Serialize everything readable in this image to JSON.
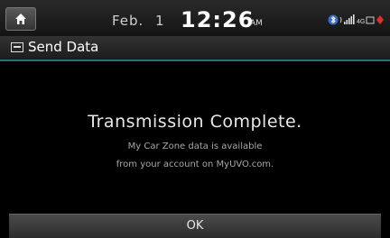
{
  "status_bar": {
    "home_icon": "home-icon",
    "date": "Feb.",
    "day": "1",
    "time": "12:26",
    "ampm": "AM",
    "icons": [
      "bluetooth-icon",
      "signal-icon",
      "network-icon",
      "battery-icon"
    ],
    "alert_color": "#e0302a"
  },
  "title_bar": {
    "icon": "send-data-icon",
    "title": "Send Data",
    "accent_color": "#2b6d7c"
  },
  "message": {
    "title": "Transmission Complete.",
    "line1": "My Car Zone data is available",
    "line2": "from your account on MyUVO.com."
  },
  "buttons": {
    "ok_label": "OK"
  }
}
